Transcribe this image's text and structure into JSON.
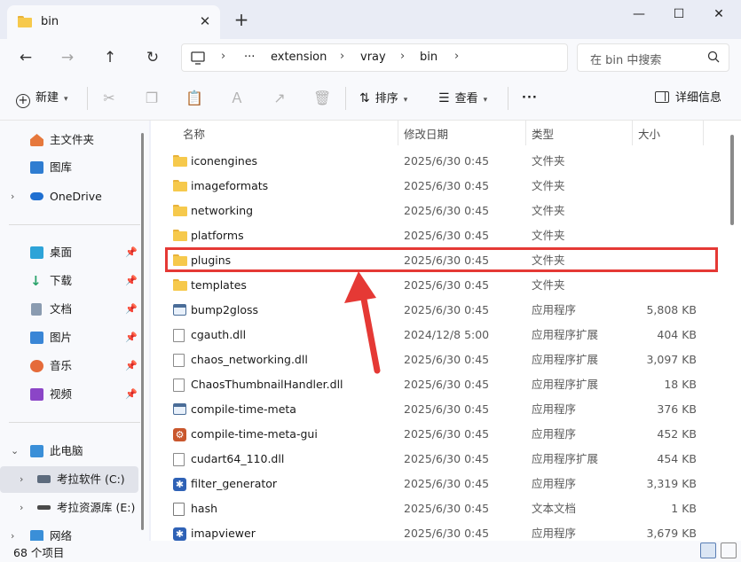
{
  "window": {
    "tab_title": "bin",
    "tab_close": "✕",
    "new_tab": "+",
    "minimize": "—",
    "maximize": "☐",
    "close": "✕"
  },
  "nav": {
    "breadcrumb": [
      "extension",
      "vray",
      "bin"
    ],
    "ellipsis": "···",
    "search_placeholder": "在 bin 中搜索"
  },
  "toolbar": {
    "new_label": "新建",
    "sort_label": "排序",
    "view_label": "查看",
    "more": "···",
    "details_label": "详细信息"
  },
  "sidebar": {
    "top_items": [
      {
        "label": "主文件夹",
        "icon": "home-icon"
      },
      {
        "label": "图库",
        "icon": "gallery-icon"
      },
      {
        "label": "OneDrive",
        "icon": "cloud-icon"
      }
    ],
    "quick_access": [
      {
        "label": "桌面",
        "icon": "desktop-icon"
      },
      {
        "label": "下载",
        "icon": "download-icon"
      },
      {
        "label": "文档",
        "icon": "document-icon"
      },
      {
        "label": "图片",
        "icon": "pictures-icon"
      },
      {
        "label": "音乐",
        "icon": "music-icon"
      },
      {
        "label": "视频",
        "icon": "video-icon"
      }
    ],
    "this_pc": "此电脑",
    "drives": [
      {
        "label": "考拉软件 (C:)",
        "icon": "drive-c-icon"
      },
      {
        "label": "考拉资源库 (E:)",
        "icon": "drive-e-icon"
      }
    ],
    "network": "网络"
  },
  "columns": {
    "name": "名称",
    "date": "修改日期",
    "type": "类型",
    "size": "大小"
  },
  "files": [
    {
      "name": "iconengines",
      "date": "2025/6/30 0:45",
      "type": "文件夹",
      "size": "",
      "icon": "folder"
    },
    {
      "name": "imageformats",
      "date": "2025/6/30 0:45",
      "type": "文件夹",
      "size": "",
      "icon": "folder"
    },
    {
      "name": "networking",
      "date": "2025/6/30 0:45",
      "type": "文件夹",
      "size": "",
      "icon": "folder"
    },
    {
      "name": "platforms",
      "date": "2025/6/30 0:45",
      "type": "文件夹",
      "size": "",
      "icon": "folder"
    },
    {
      "name": "plugins",
      "date": "2025/6/30 0:45",
      "type": "文件夹",
      "size": "",
      "icon": "folder"
    },
    {
      "name": "templates",
      "date": "2025/6/30 0:45",
      "type": "文件夹",
      "size": "",
      "icon": "folder"
    },
    {
      "name": "bump2gloss",
      "date": "2025/6/30 0:45",
      "type": "应用程序",
      "size": "5,808 KB",
      "icon": "exe"
    },
    {
      "name": "cgauth.dll",
      "date": "2024/12/8 5:00",
      "type": "应用程序扩展",
      "size": "404 KB",
      "icon": "dll"
    },
    {
      "name": "chaos_networking.dll",
      "date": "2025/6/30 0:45",
      "type": "应用程序扩展",
      "size": "3,097 KB",
      "icon": "dll"
    },
    {
      "name": "ChaosThumbnailHandler.dll",
      "date": "2025/6/30 0:45",
      "type": "应用程序扩展",
      "size": "18 KB",
      "icon": "dll"
    },
    {
      "name": "compile-time-meta",
      "date": "2025/6/30 0:45",
      "type": "应用程序",
      "size": "376 KB",
      "icon": "exe"
    },
    {
      "name": "compile-time-meta-gui",
      "date": "2025/6/30 0:45",
      "type": "应用程序",
      "size": "452 KB",
      "icon": "exe-gui"
    },
    {
      "name": "cudart64_110.dll",
      "date": "2025/6/30 0:45",
      "type": "应用程序扩展",
      "size": "454 KB",
      "icon": "dll"
    },
    {
      "name": "filter_generator",
      "date": "2025/6/30 0:45",
      "type": "应用程序",
      "size": "3,319 KB",
      "icon": "exe-blue"
    },
    {
      "name": "hash",
      "date": "2025/6/30 0:45",
      "type": "文本文档",
      "size": "1 KB",
      "icon": "txt"
    },
    {
      "name": "imapviewer",
      "date": "2025/6/30 0:45",
      "type": "应用程序",
      "size": "3,679 KB",
      "icon": "exe-blue"
    }
  ],
  "status": {
    "item_count": "68 个项目"
  },
  "colors": {
    "highlight": "#e53935",
    "folder": "#f6c94c",
    "accent": "#2f62b6"
  }
}
